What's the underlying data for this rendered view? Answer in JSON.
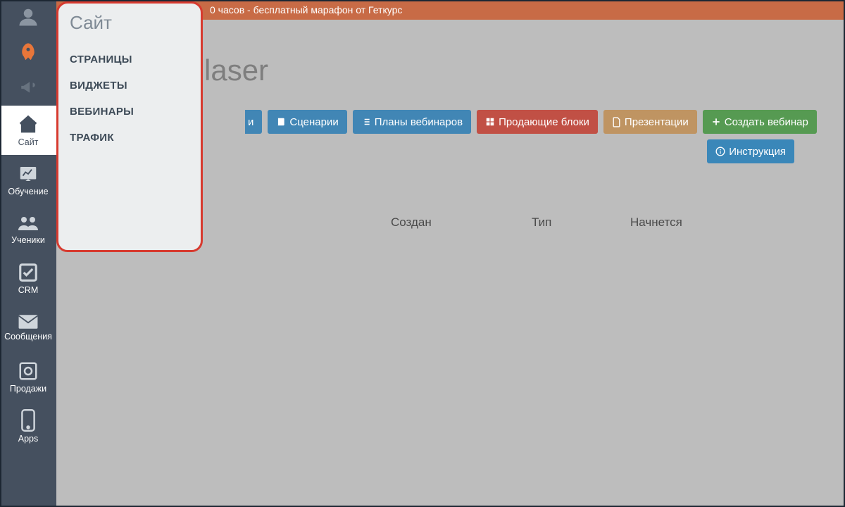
{
  "banner": {
    "text": "0 часов - бесплатный марафон от Геткурс"
  },
  "page": {
    "title_fragment": "laser"
  },
  "sidebar": {
    "items": [
      {
        "label": ""
      },
      {
        "label": ""
      },
      {
        "label": ""
      },
      {
        "label": "Сайт"
      },
      {
        "label": "Обучение"
      },
      {
        "label": "Ученики"
      },
      {
        "label": "CRM"
      },
      {
        "label": "Сообщения"
      },
      {
        "label": "Продажи"
      },
      {
        "label": "Apps"
      }
    ]
  },
  "flyout": {
    "title": "Сайт",
    "items": [
      "СТРАНИЦЫ",
      "ВИДЖЕТЫ",
      "ВЕБИНАРЫ",
      "ТРАФИК"
    ]
  },
  "actions": {
    "partial": "и",
    "scenarios": "Сценарии",
    "plans": "Планы вебинаров",
    "selling_blocks": "Продающие блоки",
    "presentations": "Презентации",
    "create_webinar": "Создать вебинар",
    "instruction": "Инструкция"
  },
  "table": {
    "headers": {
      "created": "Создан",
      "type": "Тип",
      "starts": "Начнется"
    }
  },
  "colors": {
    "sidebar": "#45505f",
    "banner": "#c86b46",
    "highlight_border": "#d73a2f",
    "blue": "#4186b5",
    "red": "#c15045",
    "tan": "#bf9462",
    "green": "#569a52",
    "info": "#3a87b9"
  }
}
